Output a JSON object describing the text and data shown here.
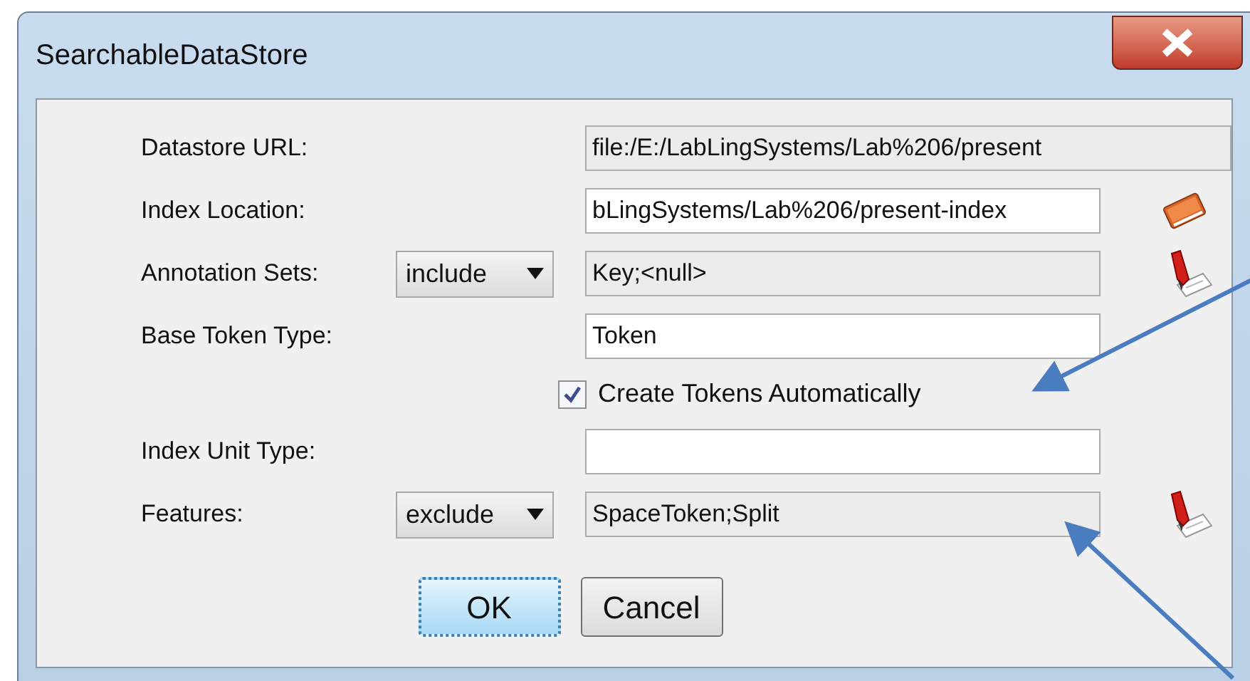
{
  "window": {
    "title": "SearchableDataStore"
  },
  "rows": [
    {
      "kind": "url",
      "label": "Datastore URL:",
      "value": "file:/E:/LabLingSystems/Lab%206/present",
      "editable": false
    },
    {
      "kind": "location",
      "label": "Index Location:",
      "value": "bLingSystems/Lab%206/present-index",
      "editable": true
    },
    {
      "kind": "list",
      "label": "Annotation Sets:",
      "selector": "include",
      "value": "Key;<null>",
      "editable": false
    },
    {
      "kind": "text",
      "label": "Base Token Type:",
      "value": "Token",
      "editable": true
    },
    {
      "kind": "checkbox",
      "label": "Create Tokens Automatically",
      "checked": true
    },
    {
      "kind": "text",
      "label": "Index Unit Type:",
      "editable": true
    },
    {
      "kind": "list",
      "label": "Features:",
      "selector": "exclude",
      "value": "SpaceToken;Split",
      "editable": false
    }
  ],
  "buttons": [
    {
      "label": "OK",
      "focused": true
    },
    {
      "label": "Cancel",
      "focused": false
    }
  ]
}
